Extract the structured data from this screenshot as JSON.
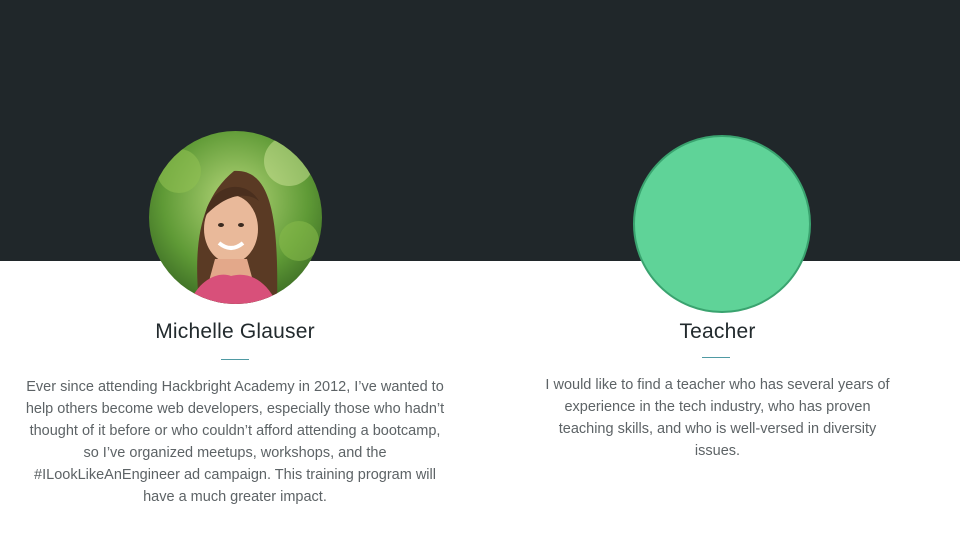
{
  "profile": {
    "name": "Michelle Glauser",
    "bio": "Ever since attending Hackbright Academy in 2012, I’ve wanted to help others become web developers, especially those who hadn’t thought of it before or who couldn’t afford attending a bootcamp, so I’ve organized meetups, workshops, and the #ILookLikeAnEngineer ad campaign. This training program will have a much greater impact."
  },
  "teacher": {
    "title": "Teacher",
    "description": "I would like to find a teacher who has several years of experience in the tech industry, who has proven teaching skills, and who is well-versed in diversity issues."
  },
  "colors": {
    "top_band": "#20272a",
    "placeholder_circle": "#5fd398",
    "divider": "#4f9aa3"
  }
}
